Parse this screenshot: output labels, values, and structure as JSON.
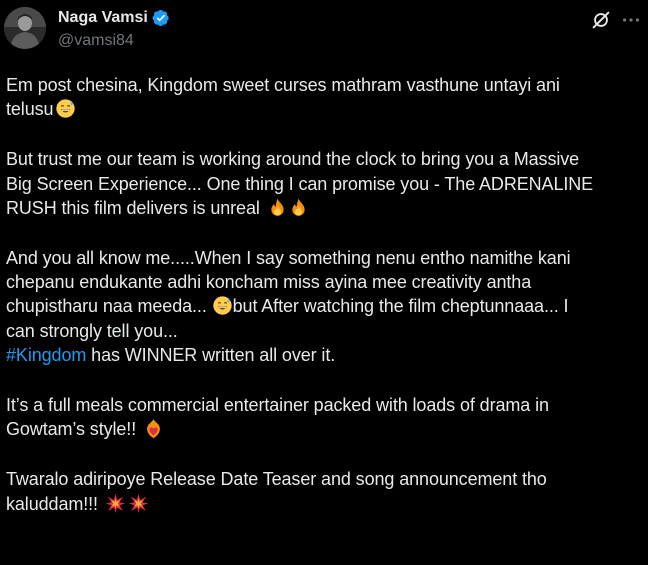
{
  "author": {
    "display_name": "Naga Vamsi",
    "handle": "@vamsi84"
  },
  "tweet": {
    "p1": {
      "l1": "Em post chesina, Kingdom sweet curses mathram vasthune untayi ani",
      "l2": "telusu"
    },
    "p2": {
      "l1": "But trust me our team is working around the clock to bring you a Massive",
      "l2": "Big Screen Experience... One thing I can promise you - The ADRENALINE",
      "l3": "RUSH this film delivers is unreal"
    },
    "p3": {
      "l1": "And you all know me.....When I say something nenu entho namithe kani",
      "l2": "chepanu endukante adhi koncham miss ayina mee creativity antha",
      "l3a": "chupistharu naa meeda...",
      "l3b": "but After watching the film cheptunnaaa... I",
      "l4": "can strongly tell you...",
      "hashtag": "#Kingdom",
      "l5_rest": " has WINNER written all over it."
    },
    "p4": {
      "l1": "It’s a full meals commercial entertainer packed with loads of drama in",
      "l2": "Gowtam’s style!!"
    },
    "p5": {
      "l1": "Twaralo adiripoye Release Date Teaser and song announcement tho",
      "l2": "kaluddam!!!"
    }
  },
  "icons": {
    "verified": "verified-badge-icon",
    "grok": "grok-icon",
    "more": "more-options-icon"
  },
  "colors": {
    "background": "#000000",
    "text": "#e7e9ea",
    "secondary": "#71767b",
    "link": "#1d9bf0",
    "verified": "#1d9bf0"
  }
}
